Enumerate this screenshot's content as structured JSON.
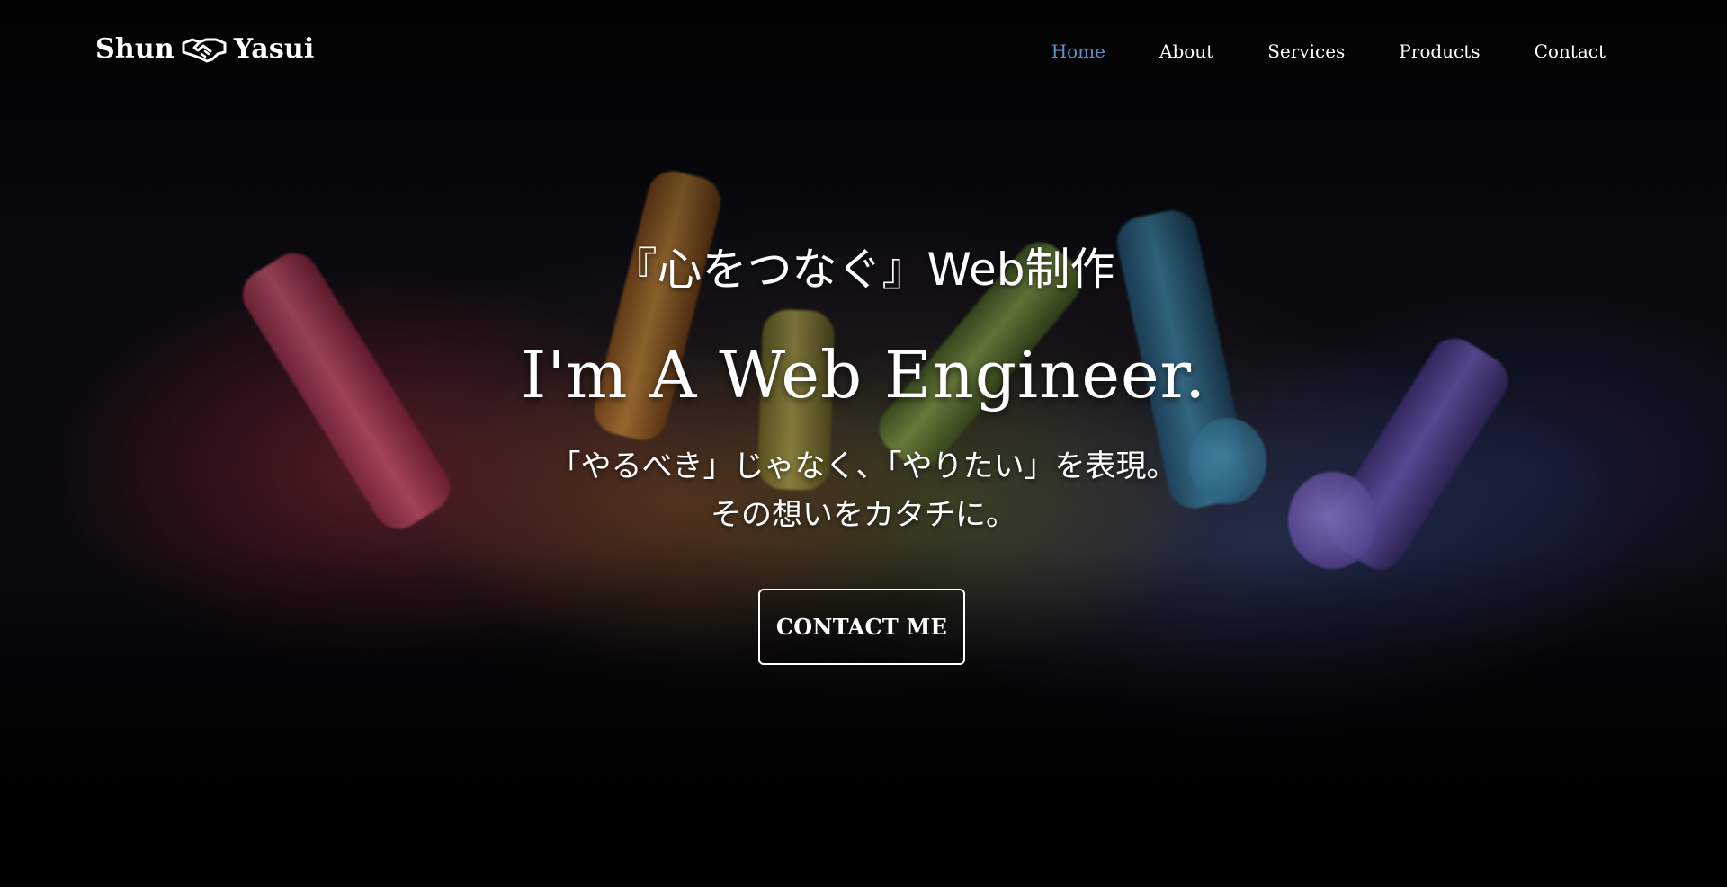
{
  "brand": {
    "first_name": "Shun",
    "last_name": "Yasui",
    "icon": "handshake-icon"
  },
  "nav": {
    "items": [
      {
        "label": "Home",
        "active": true
      },
      {
        "label": "About",
        "active": false
      },
      {
        "label": "Services",
        "active": false
      },
      {
        "label": "Products",
        "active": false
      },
      {
        "label": "Contact",
        "active": false
      }
    ],
    "active_color": "#5f8fc9"
  },
  "hero": {
    "tagline": "『心をつなぐ』Web制作",
    "headline": "I'm A Web Engineer.",
    "subtext_line1": "「やるべき」じゃなく、「やりたい」を表現。",
    "subtext_line2": "その想いをカタチに。",
    "cta_label": "CONTACT ME",
    "background": "colorful-chalk-photo"
  },
  "colors": {
    "text": "#ffffff",
    "background": "#000000"
  }
}
